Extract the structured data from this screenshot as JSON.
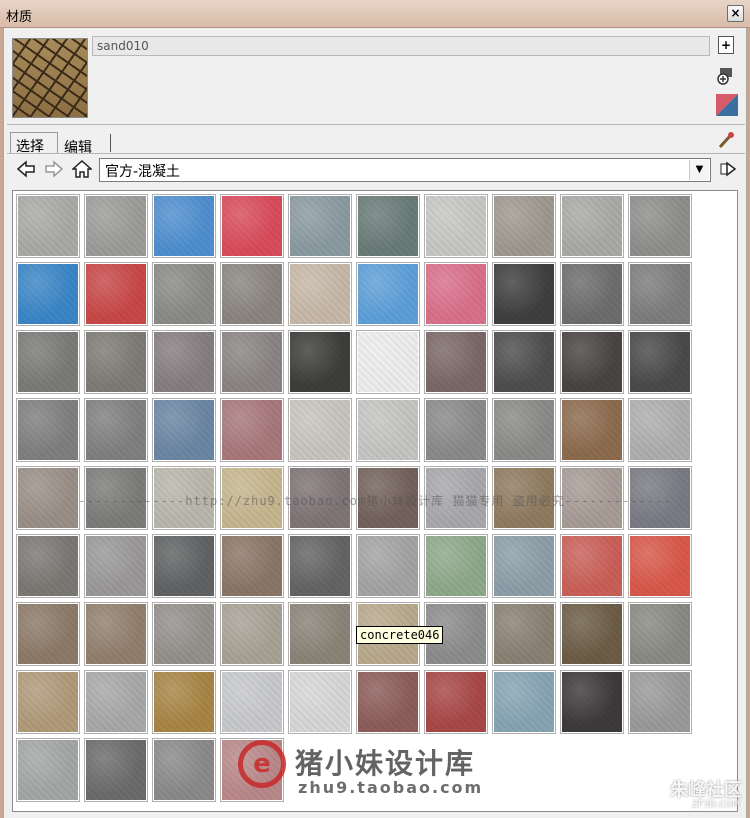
{
  "window": {
    "title": "材质",
    "close_symbol": "×"
  },
  "material": {
    "name": "sand010"
  },
  "tabs": [
    {
      "label": "选择"
    },
    {
      "label": "编辑"
    }
  ],
  "nav": {
    "back_icon": "back-arrow-icon",
    "forward_icon": "forward-arrow-icon",
    "home_icon": "home-icon",
    "collection": "官方-混凝土",
    "details_icon": "details-arrow-icon"
  },
  "tooltip": "concrete046",
  "watermarks": {
    "line": "-------------http://zhu9.taobao.com猪小妹设计库  猫猫专用  盗用必究-------------",
    "logo_text": "猪小妹设计库",
    "logo_url": "zhu9.taobao.com",
    "site": "朱峰社区",
    "site_url": "ZF3D.COM"
  },
  "swatches": [
    "#a9aaa6",
    "#9c9c9a",
    "#4f8fcf",
    "#d94c5c",
    "#8b9aa1",
    "#6a7b78",
    "#c6c6c4",
    "#9f9890",
    "#a9a9a6",
    "#8e8e8c",
    "#3b86c6",
    "#c84848",
    "#8a8a86",
    "#8a8580",
    "#c6b8a8",
    "#5e9fd8",
    "#d9708a",
    "#3f3f3f",
    "#6d6d6d",
    "#7d7d7d",
    "#7a7a78",
    "#7e7b76",
    "#857e80",
    "#8a8584",
    "#3d3d3a",
    "#ececec",
    "#7a6866",
    "#4e4e4e",
    "#4a4444",
    "#4a4a4a",
    "#7f7f7f",
    "#808080",
    "#6b86a3",
    "#a8787b",
    "#c6c4bc",
    "#c4c4c2",
    "#8a8a8a",
    "#8a8a88",
    "#8c6b4e",
    "#aeaeae",
    "#9a8f87",
    "#7c7d7a",
    "#b9b6ab",
    "#c6b68f",
    "#7f7476",
    "#73625b",
    "#a8a8ac",
    "#8f7b60",
    "#a79c95",
    "#7a7a84",
    "#7b7874",
    "#9a9898",
    "#606263",
    "#8a7666",
    "#646464",
    "#a3a3a3",
    "#8ea88a",
    "#8c9ea8",
    "#c96058",
    "#d8584a",
    "#8c7a68",
    "#92806e",
    "#94908c",
    "#a8a296",
    "#8a8478",
    "#b8a98c",
    "#8c8c8c",
    "#8a8074",
    "#6c5d46",
    "#8a8a84",
    "#b09a7a",
    "#a8a8a8",
    "#a88545",
    "#c7c8cb",
    "#d6d6d6",
    "#8c5d5a",
    "#a84848",
    "#87a4b3",
    "#3d3a3c",
    "#9a9a9a",
    "#a4a6a6",
    "#6c6c6c",
    "#8a8a8a",
    "#b9898a"
  ]
}
